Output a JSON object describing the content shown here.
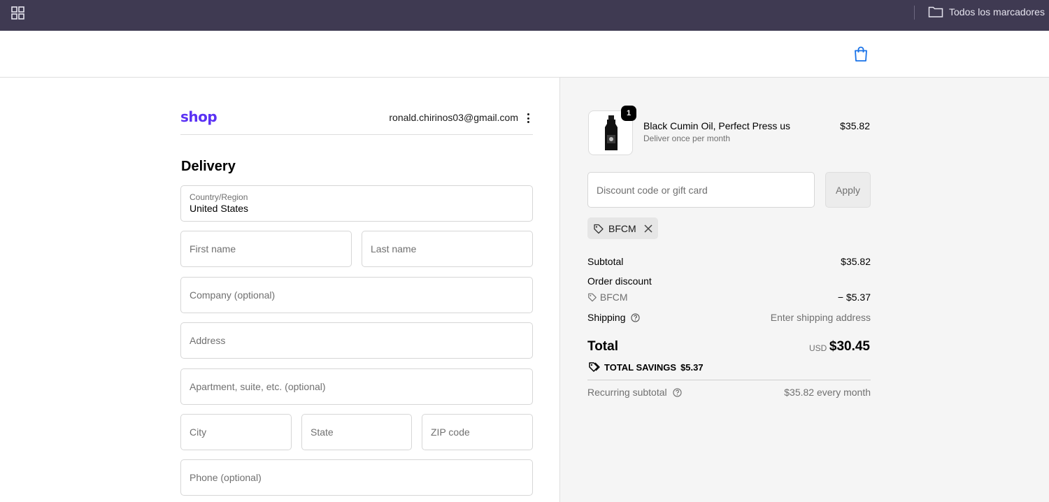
{
  "browser": {
    "bookmarks_folder": "Todos los marcadores"
  },
  "account": {
    "logo": "shop",
    "email": "ronald.chirinos03@gmail.com"
  },
  "delivery": {
    "title": "Delivery",
    "country_label": "Country/Region",
    "country_value": "United States",
    "placeholders": {
      "first_name": "First name",
      "last_name": "Last name",
      "company": "Company (optional)",
      "address": "Address",
      "apartment": "Apartment, suite, etc. (optional)",
      "city": "City",
      "state": "State",
      "zip": "ZIP code",
      "phone": "Phone (optional)"
    }
  },
  "order": {
    "product": {
      "quantity": "1",
      "name": "Black Cumin Oil, Perfect Press us",
      "subscription": "Deliver once per month",
      "price": "$35.82"
    },
    "discount_placeholder": "Discount code or gift card",
    "apply_label": "Apply",
    "applied_code": "BFCM",
    "summary": {
      "subtotal_label": "Subtotal",
      "subtotal_value": "$35.82",
      "order_discount_label": "Order discount",
      "discount_code": "BFCM",
      "discount_value": "− $5.37",
      "shipping_label": "Shipping",
      "shipping_value": "Enter shipping address",
      "total_label": "Total",
      "currency": "USD",
      "total_value": "$30.45",
      "savings_label": "TOTAL SAVINGS",
      "savings_value": "$5.37",
      "recurring_label": "Recurring subtotal",
      "recurring_value": "$35.82 every month"
    }
  },
  "colors": {
    "browser_bar": "#3f3a52",
    "shop_brand": "#5a31f4",
    "link_blue": "#1a73e8",
    "summary_bg": "#f5f5f5"
  }
}
